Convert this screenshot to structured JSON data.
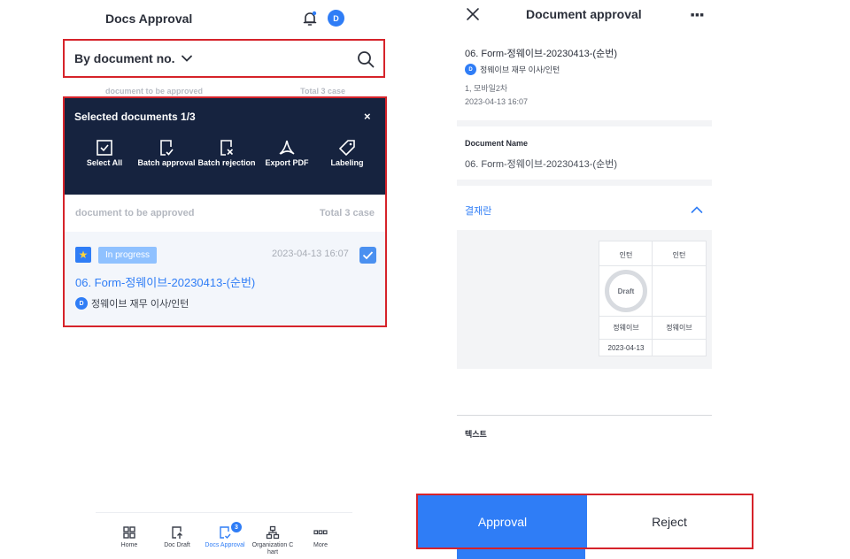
{
  "left": {
    "header": {
      "title": "Docs Approval",
      "avatar": "D"
    },
    "search": {
      "selected": "By document no."
    },
    "ghost": {
      "left": "document to be approved",
      "right": "Total 3 case"
    },
    "selection": {
      "title": "Selected documents 1/3",
      "close": "×",
      "actions": [
        {
          "label": "Select All",
          "icon": "check-square-icon"
        },
        {
          "label": "Batch approval",
          "icon": "doc-check-icon"
        },
        {
          "label": "Batch rejection",
          "icon": "doc-x-icon"
        },
        {
          "label": "Export PDF",
          "icon": "pdf-icon"
        },
        {
          "label": "Labeling",
          "icon": "tag-icon"
        }
      ]
    },
    "subrow": {
      "left": "document to be approved",
      "right": "Total 3 case"
    },
    "doc": {
      "status": "In progress",
      "date": "2023-04-13 16:07",
      "title": "06. Form-정웨이브-20230413-(순번)",
      "author": "정웨이브 재무 이사/인턴",
      "avatar": "D"
    },
    "nav": [
      {
        "label": "Home",
        "icon": "grid-icon"
      },
      {
        "label": "Doc Draft",
        "icon": "doc-upload-icon"
      },
      {
        "label": "Docs Approval",
        "icon": "doc-check-icon",
        "badge": "3"
      },
      {
        "label": "Organization C hart",
        "icon": "org-chart-icon"
      },
      {
        "label": "More",
        "icon": "more-icon"
      }
    ]
  },
  "right": {
    "header": {
      "title": "Document approval",
      "more": "■■■"
    },
    "info": {
      "title": "06. Form-정웨이브-20230413-(순번)",
      "author": "정웨이브 재무 이사/인턴",
      "avatar": "D",
      "dept": "1, 모바일2차",
      "date": "2023-04-13 16:07"
    },
    "doc_name": {
      "label": "Document Name",
      "value": "06. Form-정웨이브-20230413-(순번)"
    },
    "approval_section": {
      "title": "결재란",
      "columns": [
        {
          "role": "인턴",
          "stamp": "Draft",
          "name": "정웨이브",
          "date": "2023-04-13"
        },
        {
          "role": "인턴",
          "stamp": "",
          "name": "정웨이브",
          "date": ""
        }
      ]
    },
    "text_label": "텍스트",
    "buttons": {
      "approve": "Approval",
      "reject": "Reject"
    }
  },
  "colors": {
    "accent": "#2f7df6",
    "dark": "#16233f",
    "highlight": "#d6232a"
  }
}
